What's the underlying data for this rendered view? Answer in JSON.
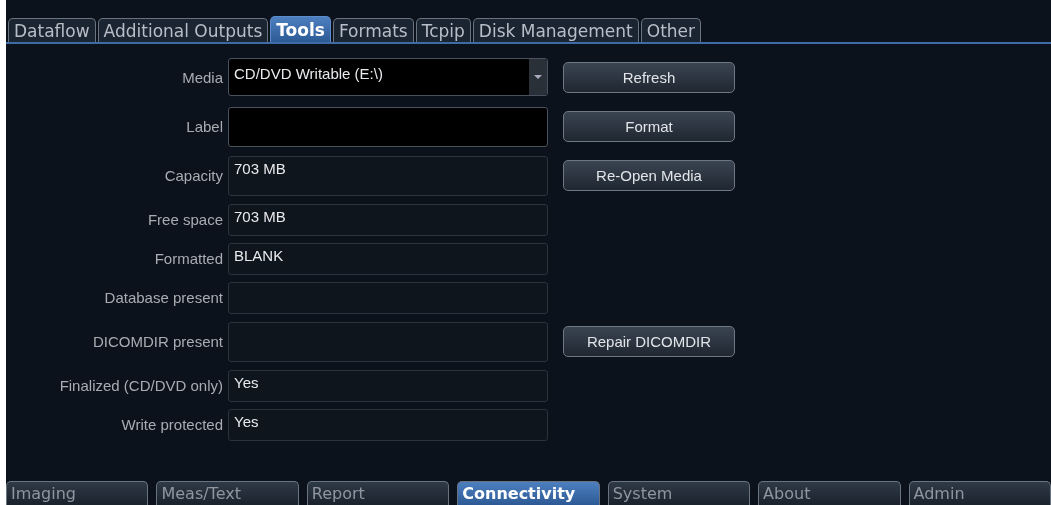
{
  "top_tabs": [
    {
      "label": "Dataflow",
      "selected": false
    },
    {
      "label": "Additional Outputs",
      "selected": false
    },
    {
      "label": "Tools",
      "selected": true
    },
    {
      "label": "Formats",
      "selected": false
    },
    {
      "label": "Tcpip",
      "selected": false
    },
    {
      "label": "Disk Management",
      "selected": false
    },
    {
      "label": "Other",
      "selected": false
    }
  ],
  "rows": [
    {
      "label": "Media",
      "kind": "dropdown",
      "value": "CD/DVD Writable (E:\\)",
      "button": "Refresh"
    },
    {
      "label": "Label",
      "kind": "input",
      "value": "",
      "button": "Format"
    },
    {
      "label": "Capacity",
      "kind": "readonly",
      "value": "703 MB",
      "button": "Re-Open Media"
    },
    {
      "label": "Free space",
      "kind": "readonly",
      "value": "703 MB"
    },
    {
      "label": "Formatted",
      "kind": "readonly",
      "value": "BLANK"
    },
    {
      "label": "Database present",
      "kind": "readonly",
      "value": ""
    },
    {
      "label": "DICOMDIR present",
      "kind": "readonly",
      "value": "",
      "button": "Repair DICOMDIR"
    },
    {
      "label": "Finalized (CD/DVD only)",
      "kind": "readonly",
      "value": "Yes"
    },
    {
      "label": "Write protected",
      "kind": "readonly",
      "value": "Yes"
    }
  ],
  "bottom_tabs": [
    {
      "label": "Imaging",
      "selected": false
    },
    {
      "label": "Meas/Text",
      "selected": false
    },
    {
      "label": "Report",
      "selected": false
    },
    {
      "label": "Connectivity",
      "selected": true
    },
    {
      "label": "System",
      "selected": false
    },
    {
      "label": "About",
      "selected": false
    },
    {
      "label": "Admin",
      "selected": false
    }
  ]
}
